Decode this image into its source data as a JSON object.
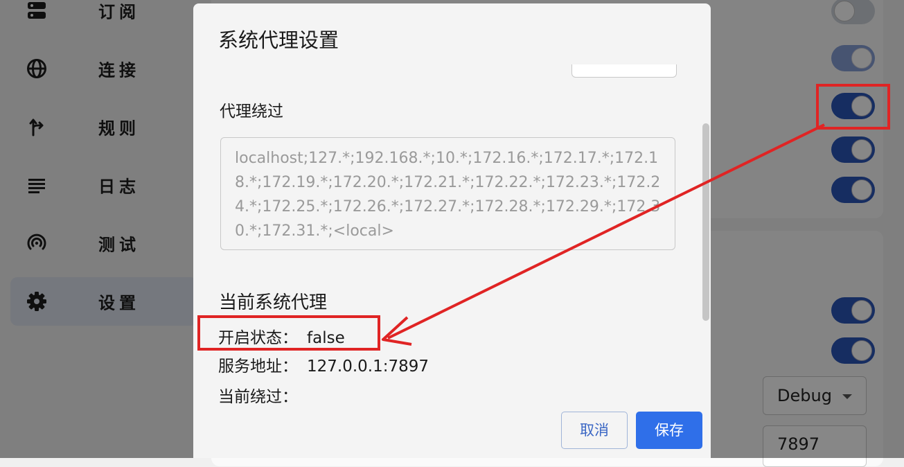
{
  "sidebar": {
    "items": [
      {
        "label": "订阅",
        "icon": "subscription-icon"
      },
      {
        "label": "连接",
        "icon": "globe-icon"
      },
      {
        "label": "规则",
        "icon": "route-icon"
      },
      {
        "label": "日志",
        "icon": "log-list-icon"
      },
      {
        "label": "测试",
        "icon": "signal-icon"
      },
      {
        "label": "设置",
        "icon": "gear-icon",
        "active": true
      }
    ]
  },
  "background_settings": {
    "toggles": [
      {
        "on": false
      },
      {
        "on": true,
        "disabled": true
      },
      {
        "on": true
      },
      {
        "on": true
      },
      {
        "on": true
      },
      {
        "on": true
      },
      {
        "on": true
      }
    ],
    "log_level": "Debug",
    "port": "7897"
  },
  "dialog": {
    "title": "系统代理设置",
    "bypass_label": "代理绕过",
    "bypass_value": "localhost;127.*;192.168.*;10.*;172.16.*;172.17.*;172.18.*;172.19.*;172.20.*;172.21.*;172.22.*;172.23.*;172.24.*;172.25.*;172.26.*;172.27.*;172.28.*;172.29.*;172.30.*;172.31.*;<local>",
    "current_title": "当前系统代理",
    "enabled_label": "开启状态：",
    "enabled_value": "false",
    "server_label": "服务地址：",
    "server_value": "127.0.0.1:7897",
    "bypass_current_label": "当前绕过：",
    "bypass_current_value": "",
    "cancel_label": "取消",
    "save_label": "保存"
  },
  "colors": {
    "accent": "#2f6fe9",
    "toggle_on": "#2b55b8",
    "annotation": "#e02424"
  }
}
